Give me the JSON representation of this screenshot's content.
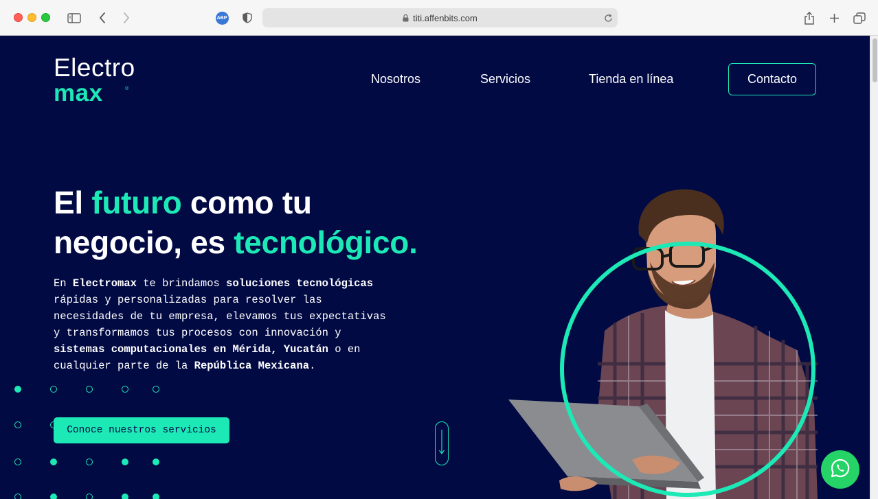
{
  "browser": {
    "url": "titi.affenbits.com",
    "adblock_badge": "ABP",
    "icons": [
      "sidebar-icon",
      "back-icon",
      "forward-icon",
      "adblock-icon",
      "privacy-shield-icon",
      "lock-icon",
      "reload-icon",
      "share-icon",
      "new-tab-icon",
      "tab-overview-icon"
    ]
  },
  "logo": {
    "line1": "Electro",
    "line2": "max",
    "registered": "®"
  },
  "nav": {
    "nosotros": "Nosotros",
    "servicios": "Servicios",
    "tienda": "Tienda en línea",
    "contacto": "Contacto"
  },
  "hero": {
    "headline": {
      "p1": "El ",
      "p2": "futuro",
      "p3": " como tu",
      "p4": "negocio, es ",
      "p5": "tecnológico."
    },
    "intro": {
      "s1": "En ",
      "s2": "Electromax",
      "s3": " te brindamos ",
      "s4": "soluciones tecnológicas",
      "s5": " rápidas y personalizadas para resolver las necesidades de tu empresa, elevamos tus expectativas y transformamos tus procesos con innovación y ",
      "s6": "sistemas computacionales en Mérida, Yucatán",
      "s7": " o en cualquier parte de la ",
      "s8": "República Mexicana",
      "s9": "."
    },
    "cta": "Conoce nuestros servicios",
    "image_subject": "man with glasses and checked shirt using laptop inside a teal circle"
  },
  "colors": {
    "background": "#020a44",
    "accent": "#1de9b6",
    "whatsapp": "#25d366",
    "text": "#ffffff"
  },
  "floating": {
    "whatsapp_icon": "whatsapp-icon"
  }
}
